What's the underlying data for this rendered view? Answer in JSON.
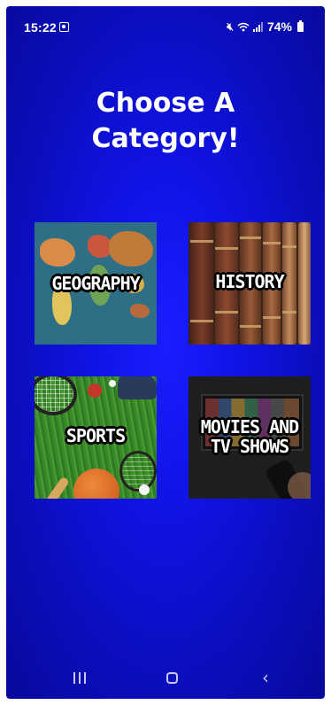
{
  "status_bar": {
    "time": "15:22",
    "battery_pct": "74%"
  },
  "title": {
    "line1": "Choose A",
    "line2": "Category!"
  },
  "categories": [
    {
      "label_lines": [
        "GEOGRAPHY"
      ],
      "image": "world-map"
    },
    {
      "label_lines": [
        "HISTORY"
      ],
      "image": "old-books"
    },
    {
      "label_lines": [
        "SPORTS"
      ],
      "image": "sports-equipment-on-grass"
    },
    {
      "label_lines": [
        "MOVIES AND",
        "TV SHOWS"
      ],
      "image": "tv-screen-with-remote"
    }
  ],
  "nav_bar": {
    "recents_icon": "recents-icon",
    "home_icon": "home-icon",
    "back_icon": "back-icon"
  },
  "colors": {
    "background": "#1114e8",
    "text": "#ffffff"
  }
}
